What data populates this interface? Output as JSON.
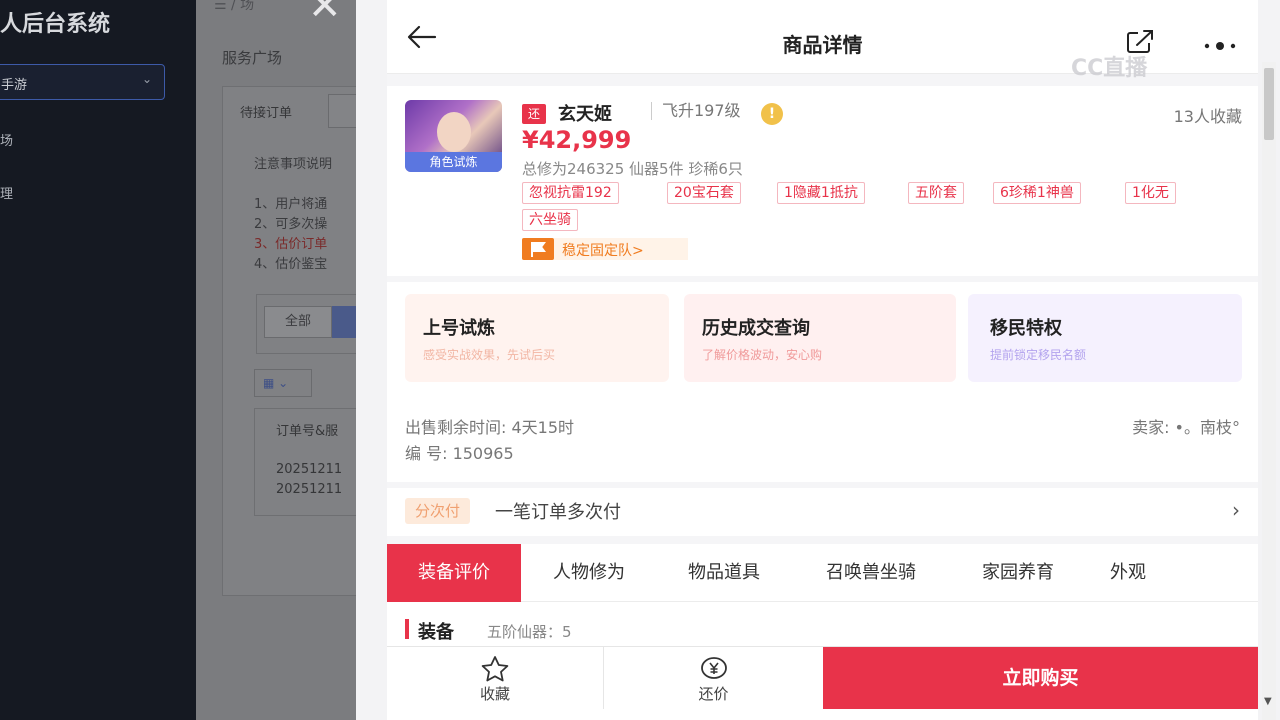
{
  "background": {
    "brand": "人后台系统",
    "menu_select": "手游",
    "menu_items": [
      "场",
      "理"
    ],
    "breadcrumb": "/ 场",
    "page_title": "服务广场",
    "tab_pending": "待接订单",
    "notice_title": "注意事项说明",
    "notice_lines": [
      "1、用户将通",
      "2、可多次操",
      "3、估价订单",
      "4、估价鉴宝"
    ],
    "filter_all": "全部",
    "table_header": "订单号&服",
    "table_rows": [
      "20251211",
      "20251211"
    ]
  },
  "header": {
    "title": "商品详情",
    "watermark": "CC直播"
  },
  "product": {
    "tag": "还",
    "name": "玄天姬",
    "level": "飞升197级",
    "warn": "!",
    "favorites": "13人收藏",
    "avatar_badge": "角色试炼",
    "price": "¥42,999",
    "stats": "总修为246325  仙器5件  珍稀6只",
    "tags": [
      "忽视抗雷192",
      "20宝石套",
      "1隐藏1抵抗",
      "五阶套",
      "6珍稀1神兽",
      "1化无",
      "六坐骑"
    ],
    "team": "稳定固定队>"
  },
  "services": [
    {
      "title": "上号试炼",
      "subtitle": "感受实战效果，先试后买",
      "bg": "#fff3ef",
      "color": "#f2b6a4"
    },
    {
      "title": "历史成交查询",
      "subtitle": "了解价格波动，安心购",
      "bg": "#fff0f0",
      "color": "#f09a9a"
    },
    {
      "title": "移民特权",
      "subtitle": "提前锁定移民名额",
      "bg": "#f5f1fe",
      "color": "#b3a3ee"
    }
  ],
  "info": {
    "time_left": "出售剩余时间: 4天15时",
    "number": "编 号: 150965",
    "seller": "卖家: •。南枝°"
  },
  "pay": {
    "tag": "分次付",
    "text": "一笔订单多次付"
  },
  "tabs": [
    "装备评价",
    "人物修为",
    "物品道具",
    "召唤兽坐骑",
    "家园养育",
    "外观"
  ],
  "equip": {
    "title": "装备",
    "subtitle": "五阶仙器：5"
  },
  "bottom": {
    "favorite": "收藏",
    "bargain": "还价",
    "buy": "立即购买"
  },
  "colors": {
    "accent": "#e8334a",
    "orange": "#f07c20"
  }
}
